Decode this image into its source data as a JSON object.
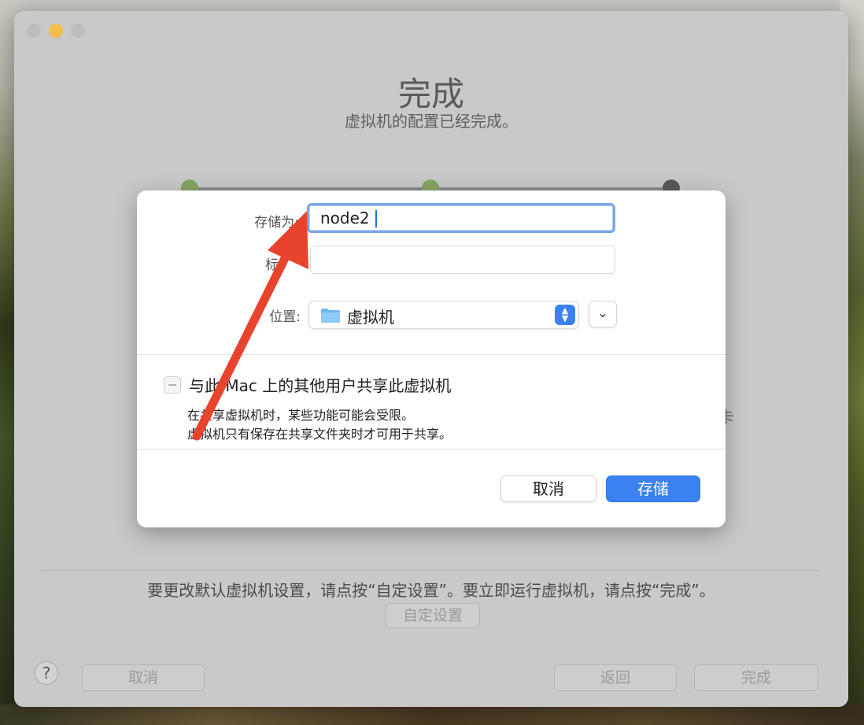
{
  "window": {
    "title": "完成",
    "subtitle": "虚拟机的配置已经完成。",
    "trailing_char": "卡",
    "hint": "要更改默认虚拟机设置，请点按“自定设置”。要立即运行虚拟机，请点按“完成”。",
    "custom_settings_label": "自定设置",
    "help_label": "?",
    "footer": {
      "cancel_label": "取消",
      "back_label": "返回",
      "finish_label": "完成"
    }
  },
  "sheet": {
    "save_as_label": "存储为:",
    "save_as_value": "node2",
    "tags_label": "标",
    "tags_value": "",
    "location_label": "位置:",
    "location_value": "虚拟机",
    "share_label": "与此 Mac 上的其他用户共享此虚拟机",
    "share_checked": false,
    "note_line1": "在共享虚拟机时，某些功能可能会受限。",
    "note_line2": "虚拟机只有保存在共享文件夹时才可用于共享。",
    "cancel_label": "取消",
    "save_label": "存储"
  },
  "colors": {
    "accent": "#3b82f0",
    "annotation_arrow": "#e8432c",
    "step_done": "#87a464"
  },
  "icons": [
    "folder-icon",
    "stepper-icon",
    "chevron-down-icon",
    "help-icon",
    "red-arrow-annotation"
  ]
}
